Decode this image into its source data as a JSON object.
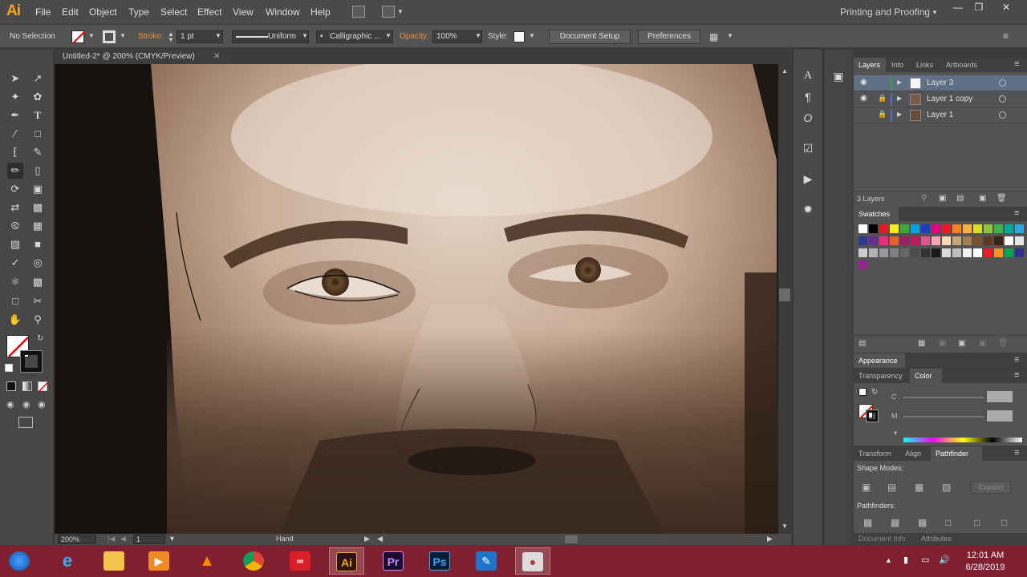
{
  "app": {
    "logo": "Ai",
    "menus": [
      "File",
      "Edit",
      "Object",
      "Type",
      "Select",
      "Effect",
      "View",
      "Window",
      "Help"
    ],
    "workspace": "Printing and Proofing",
    "window_controls": [
      "minimize",
      "restore",
      "close"
    ]
  },
  "controlbar": {
    "selection": "No Selection",
    "stroke_label": "Stroke:",
    "stroke_weight": "1 pt",
    "stroke_profile": "Uniform",
    "brush": "Calligraphic ...",
    "opacity_label": "Opacity:",
    "opacity_value": "100%",
    "style_label": "Style:",
    "document_setup": "Document Setup",
    "preferences": "Preferences"
  },
  "document": {
    "tab_title": "Untitled-2* @ 200% (CMYK/Preview)",
    "zoom": "200%",
    "artboard": "1",
    "status_tool": "Hand"
  },
  "layers_panel": {
    "tabs": [
      "Layers",
      "Info",
      "Links",
      "Artboards"
    ],
    "layers": [
      {
        "name": "Layer 3",
        "visible": true,
        "locked": false,
        "selected": true,
        "color": "#3ba33b"
      },
      {
        "name": "Layer 1 copy",
        "visible": true,
        "locked": true,
        "selected": false,
        "color": "#4f6bd6"
      },
      {
        "name": "Layer 1",
        "visible": false,
        "locked": true,
        "selected": false,
        "color": "#4f6bd6"
      }
    ],
    "count": "3 Layers"
  },
  "swatches_panel": {
    "tab": "Swatches",
    "colors": [
      "#ffffff",
      "#000000",
      "#e11b22",
      "#f7ec13",
      "#3aa935",
      "#00a3e0",
      "#1a3ec1",
      "#e5007e",
      "#ed1c24",
      "#f58220",
      "#fbb040",
      "#d7df23",
      "#8dc63f",
      "#39b54a",
      "#00a79d",
      "#27aae1",
      "#2b3990",
      "#662d91",
      "#ee2a7b",
      "#f15a29",
      "#9e1f63",
      "#c2185b",
      "#e0558f",
      "#f6a6b2",
      "#fbd7b5",
      "#c7a77a",
      "#a37c52",
      "#7b5230",
      "#5c3a1e",
      "#3b2413",
      "#ffffff",
      "#e6e6e6",
      "#cccccc",
      "#b3b3b3",
      "#999999",
      "#808080",
      "#666666",
      "#4d4d4d",
      "#333333",
      "#1a1a1a",
      "#d9d9d9",
      "#bfbfbf",
      "#f2f2f2",
      "#ffffff",
      "#ed1c24",
      "#f7941d",
      "#00a651",
      "#2e3192",
      "#92278f"
    ]
  },
  "appearance_panel": {
    "tab": "Appearance"
  },
  "color_panel": {
    "tabs": [
      "Transparency",
      "Color"
    ],
    "channels": [
      "C",
      "M"
    ]
  },
  "pathfinder_panel": {
    "tabs": [
      "Transform",
      "Align",
      "Pathfinder"
    ],
    "shape_modes": "Shape Modes:",
    "expand": "Expand",
    "pathfinders": "Pathfinders:"
  },
  "bottom_panel_tabs": [
    "Document Info",
    "Attributes"
  ],
  "taskbar": {
    "apps": [
      "Start",
      "Internet Explorer",
      "File Explorer",
      "Media Player",
      "VLC",
      "Chrome",
      "Creative Cloud",
      "Illustrator",
      "Premiere Pro",
      "Photoshop",
      "Pen Tool App",
      "Recorder"
    ],
    "time": "12:01 AM",
    "date": "6/28/2019"
  }
}
